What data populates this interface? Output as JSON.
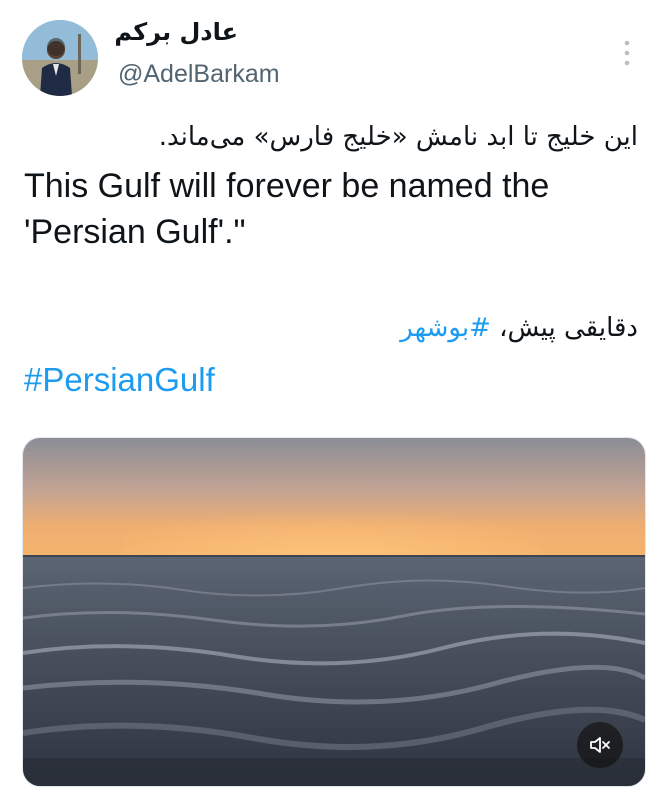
{
  "tweet": {
    "author_name": "عادل برکم",
    "handle": "@AdelBarkam",
    "text_fa": "این خلیج تا ابد نامش «خلیج فارس» می‌ماند.",
    "text_en": "This Gulf will forever be named the 'Persian Gulf'.\"",
    "location_text": "دقایقی پیش، ",
    "location_tag": "#بوشهر",
    "hashtag": "#PersianGulf"
  },
  "icons": {
    "more": "more-vertical-icon",
    "volume": "volume-muted-icon"
  },
  "colors": {
    "link": "#1d9bf0",
    "text": "#0f1419",
    "secondary": "#536471"
  }
}
